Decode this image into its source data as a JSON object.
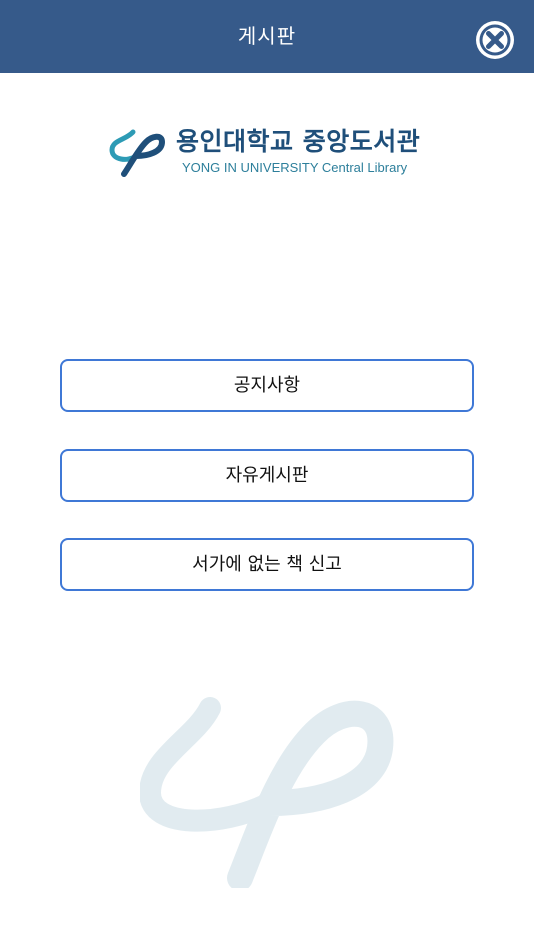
{
  "header": {
    "title": "게시판",
    "close_icon": "close-circle-icon",
    "background_color": "#365a8a"
  },
  "logo": {
    "korean_name": "용인대학교 중앙도서관",
    "english_name": "YONG IN UNIVERSITY Central Library",
    "mark_icon": "ribbon-logo-icon",
    "brand_colors": [
      "#1f4f7a",
      "#2d9bb5"
    ]
  },
  "menu": {
    "items": [
      {
        "label": "공지사항"
      },
      {
        "label": "자유게시판"
      },
      {
        "label": "서가에 없는 책 신고"
      }
    ],
    "border_color": "#3f78d6"
  },
  "watermark": {
    "icon": "ribbon-watermark-icon"
  }
}
